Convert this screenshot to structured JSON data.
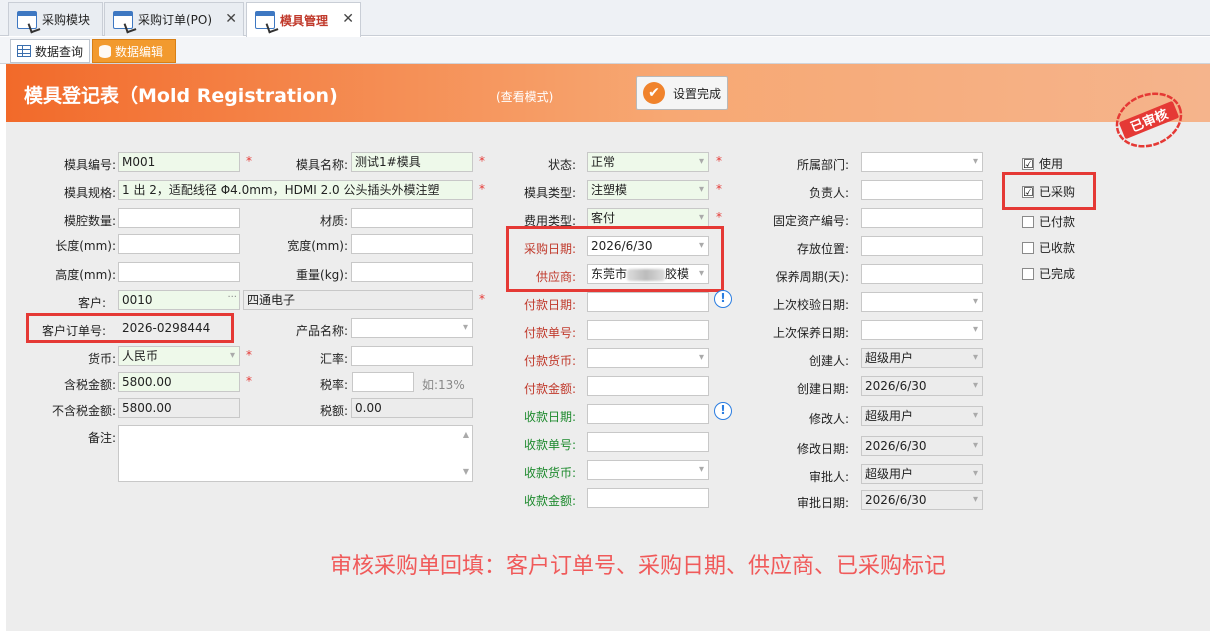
{
  "tabs": [
    {
      "label": "采购模块",
      "close": ""
    },
    {
      "label": "采购订单(PO)",
      "close": "✕"
    },
    {
      "label": "模具管理",
      "close": "✕"
    }
  ],
  "subtabs": [
    {
      "label": "数据查询"
    },
    {
      "label": "数据编辑"
    }
  ],
  "header": {
    "title": "模具登记表（Mold Registration)",
    "mode": "(查看模式)",
    "done_label": "设置完成"
  },
  "col1": {
    "mold_no_label": "模具编号:",
    "mold_no": "M001",
    "mold_name_label": "模具名称:",
    "mold_name": "测试1#模具",
    "spec_label": "模具规格:",
    "spec": "1 出 2，适配线径 Φ4.0mm，HDMI 2.0 公头插头外模注塑",
    "cavity_label": "模腔数量:",
    "material_label": "材质:",
    "length_label": "长度(mm):",
    "width_label": "宽度(mm):",
    "height_label": "高度(mm):",
    "weight_label": "重量(kg):",
    "customer_label": "客户:",
    "customer_code": "0010",
    "customer_name": "四通电子",
    "cust_order_label": "客户订单号:",
    "cust_order": "2026-0298444",
    "product_label": "产品名称:",
    "currency_label": "货币:",
    "currency": "人民币",
    "rate_label": "汇率:",
    "amount_tax_label": "含税金额:",
    "amount_tax": "5800.00",
    "tax_rate_label": "税率:",
    "tax_rate_hint": "如:13%",
    "amount_notax_label": "不含税金额:",
    "amount_notax": "5800.00",
    "tax_amount_label": "税额:",
    "tax_amount": "0.00",
    "remark_label": "备注:"
  },
  "col2": {
    "status_label": "状态:",
    "status": "正常",
    "type_label": "模具类型:",
    "type": "注塑模",
    "fee_label": "费用类型:",
    "fee": "客付",
    "purchase_date_label": "采购日期:",
    "purchase_date": "2026/6/30",
    "supplier_label": "供应商:",
    "supplier_prefix": "东莞市",
    "supplier_suffix": "胶模",
    "pay_date_label": "付款日期:",
    "pay_no_label": "付款单号:",
    "pay_cur_label": "付款货币:",
    "pay_amt_label": "付款金额:",
    "rec_date_label": "收款日期:",
    "rec_no_label": "收款单号:",
    "rec_cur_label": "收款货币:",
    "rec_amt_label": "收款金额:"
  },
  "col3": {
    "dept_label": "所属部门:",
    "owner_label": "负责人:",
    "asset_label": "固定资产编号:",
    "location_label": "存放位置:",
    "maint_cycle_label": "保养周期(天):",
    "last_check_label": "上次校验日期:",
    "last_maint_label": "上次保养日期:",
    "creator_label": "创建人:",
    "creator": "超级用户",
    "create_date_label": "创建日期:",
    "create_date": "2026/6/30",
    "modifier_label": "修改人:",
    "modifier": "超级用户",
    "modify_date_label": "修改日期:",
    "modify_date": "2026/6/30",
    "approver_label": "审批人:",
    "approver": "超级用户",
    "approve_date_label": "审批日期:",
    "approve_date": "2026/6/30"
  },
  "checks": [
    {
      "label": "使用",
      "checked": "☑"
    },
    {
      "label": "已采购",
      "checked": "☑"
    },
    {
      "label": "已付款",
      "checked": ""
    },
    {
      "label": "已收款",
      "checked": ""
    },
    {
      "label": "已完成",
      "checked": ""
    }
  ],
  "stamp": {
    "text": "已审核",
    "color": "#e53935"
  },
  "note": "审核采购单回填：客户订单号、采购日期、供应商、已采购标记"
}
